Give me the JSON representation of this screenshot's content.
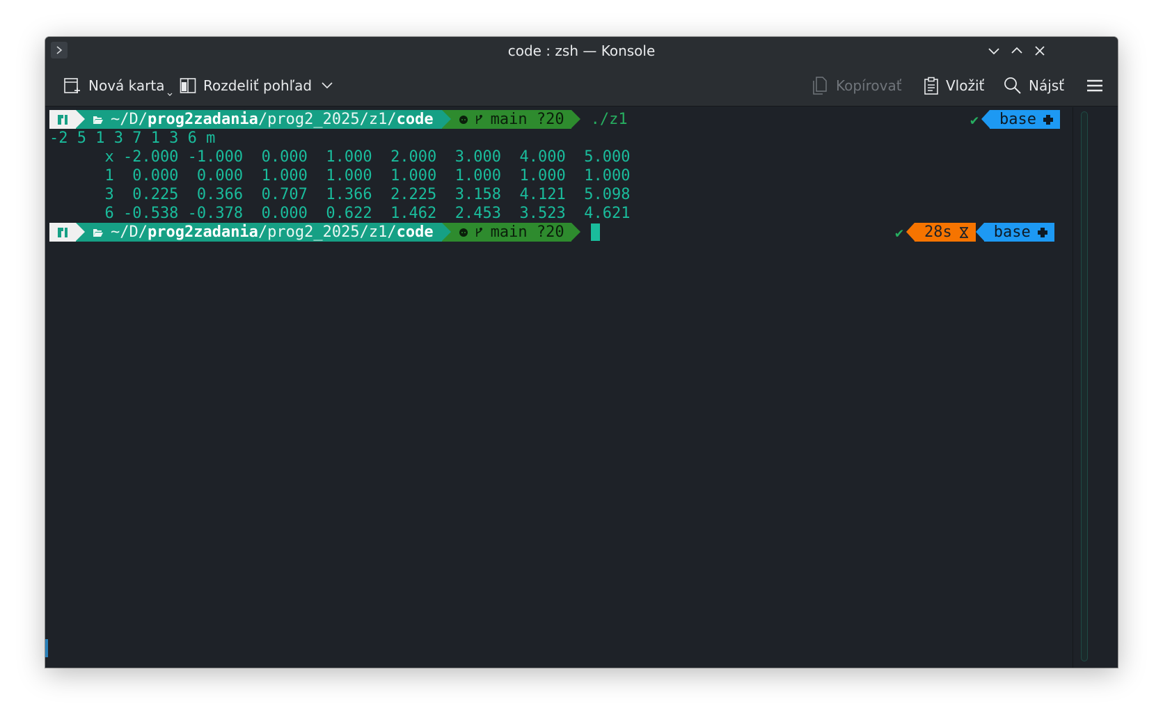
{
  "window": {
    "title": "code : zsh — Konsole"
  },
  "toolbar": {
    "new_tab": "Nová karta",
    "split_view": "Rozdeliť pohľad",
    "copy": "Kopírovať",
    "paste": "Vložiť",
    "find": "Nájsť"
  },
  "terminal": {
    "prompt1": {
      "path_prefix": "~/D/",
      "path_bold1": "prog2zadania",
      "path_mid": "/prog2_2025/z1/",
      "path_bold2": "code",
      "git": "main ?20",
      "command": "./z1",
      "env": "base"
    },
    "output": [
      "-2 5 1 3 7 1 3 6 m",
      "      x -2.000 -1.000  0.000  1.000  2.000  3.000  4.000  5.000",
      "      1  0.000  0.000  1.000  1.000  1.000  1.000  1.000  1.000",
      "      3  0.225  0.366  0.707  1.366  2.225  3.158  4.121  5.098",
      "      6 -0.538 -0.378  0.000  0.622  1.462  2.453  3.523  4.621"
    ],
    "prompt2": {
      "path_prefix": "~/D/",
      "path_bold1": "prog2zadania",
      "path_mid": "/prog2_2025/z1/",
      "path_bold2": "code",
      "git": "main ?20",
      "duration": "28s",
      "env": "base"
    },
    "status_check": "✔",
    "colors": {
      "path_segment": "#16a085",
      "git_segment": "#2e8b2e",
      "duration_segment": "#f67400",
      "env_segment": "#1d99f3",
      "output_text": "#1abc9c"
    }
  }
}
